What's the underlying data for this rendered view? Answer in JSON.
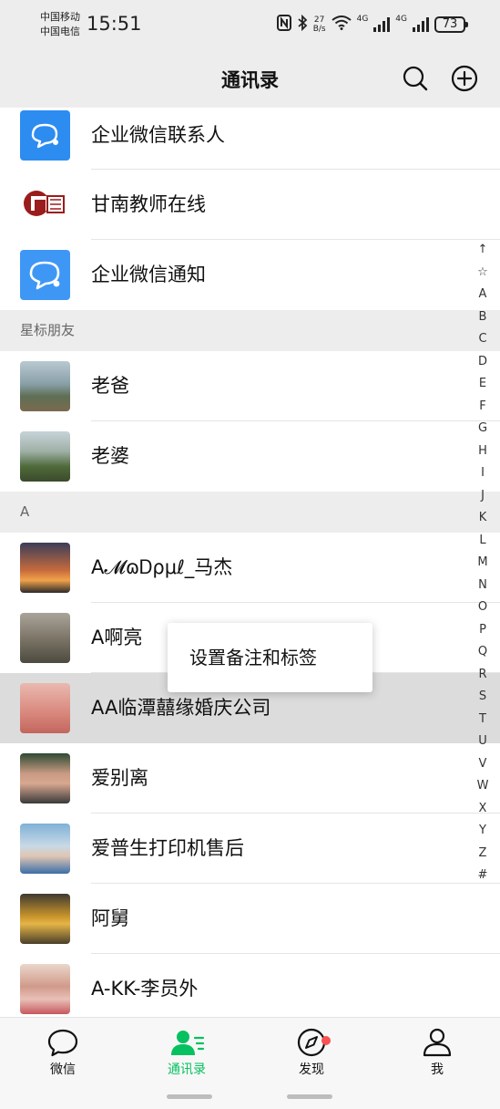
{
  "status_bar": {
    "carrier_1": "中国移动",
    "carrier_2": "中国电信",
    "time": "15:51",
    "speed_value": "27",
    "speed_unit": "B/s",
    "net_1": "4G",
    "net_2": "4G",
    "battery": "73"
  },
  "header": {
    "title": "通讯录"
  },
  "top_items": [
    {
      "name": "企业微信联系人",
      "icon": "wecom-contacts-icon"
    },
    {
      "name": "甘南教师在线",
      "icon": "gannan-teacher-logo"
    },
    {
      "name": "企业微信通知",
      "icon": "wecom-notify-icon"
    }
  ],
  "sections": {
    "starred": "星标朋友",
    "a": "A"
  },
  "starred_contacts": [
    {
      "name": "老爸"
    },
    {
      "name": "老婆"
    }
  ],
  "a_contacts": [
    {
      "name": "A𝓜ɷᎠρμℓ_马杰"
    },
    {
      "name": "A啊亮"
    },
    {
      "name": "AA临潭囍缘婚庆公司"
    },
    {
      "name": "爱别离"
    },
    {
      "name": "爱普生打印机售后"
    },
    {
      "name": "阿舅"
    },
    {
      "name": "A-KK-李员外"
    }
  ],
  "index_bar": [
    "↑",
    "☆",
    "A",
    "B",
    "C",
    "D",
    "E",
    "F",
    "G",
    "H",
    "I",
    "J",
    "K",
    "L",
    "M",
    "N",
    "O",
    "P",
    "Q",
    "R",
    "S",
    "T",
    "U",
    "V",
    "W",
    "X",
    "Y",
    "Z",
    "#"
  ],
  "popup": {
    "label": "设置备注和标签"
  },
  "tabs": [
    {
      "label": "微信",
      "icon": "chat-bubble-icon"
    },
    {
      "label": "通讯录",
      "icon": "contacts-icon"
    },
    {
      "label": "发现",
      "icon": "compass-icon"
    },
    {
      "label": "我",
      "icon": "person-icon"
    }
  ],
  "colors": {
    "accent": "#07c160",
    "wecom_blue": "#2d8cf0",
    "badge_red": "#fa5151"
  }
}
